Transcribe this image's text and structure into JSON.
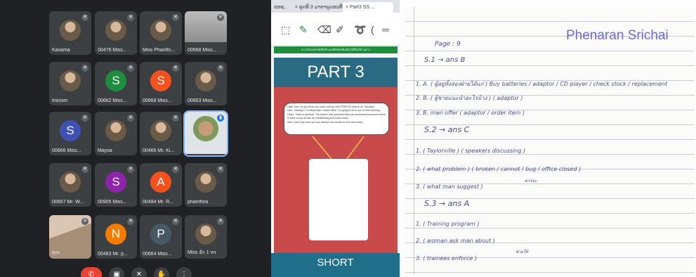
{
  "meeting": {
    "tiles": [
      {
        "name": "Kasama",
        "avatar": "photo",
        "color": "#607d8b",
        "active": false
      },
      {
        "name": "00476 Miss...",
        "avatar": "photo",
        "color": "#8d6e63",
        "active": false
      },
      {
        "name": "Miss Phanthi...",
        "avatar": "photo",
        "color": "#a1887f",
        "active": false
      },
      {
        "name": "00668 Miss...",
        "avatar": "wide",
        "color": "#9e9e9e",
        "active": false
      },
      {
        "name": "tnsnxm",
        "avatar": "photo",
        "color": "#4db6ac",
        "active": false
      },
      {
        "name": "00662 Miss...",
        "avatar": "S",
        "color": "#1e8e3e",
        "active": false
      },
      {
        "name": "00668 Miss...",
        "avatar": "S",
        "color": "#f4511e",
        "active": false
      },
      {
        "name": "00663 Miss...",
        "avatar": "photo",
        "color": "#8d6e63",
        "active": false
      },
      {
        "name": "00666 Miss...",
        "avatar": "S",
        "color": "#3f51b5",
        "active": false
      },
      {
        "name": "Maysa",
        "avatar": "photo",
        "color": "#795548",
        "active": false
      },
      {
        "name": "00466 Mr. Ki...",
        "avatar": "photo",
        "color": "#fbc02d",
        "active": false
      },
      {
        "name": "Warchuda",
        "avatar": "selfcam",
        "color": "#90a4ae",
        "active": true
      },
      {
        "name": "00667 Mr. W...",
        "avatar": "photo",
        "color": "#bcaaa4",
        "active": false
      },
      {
        "name": "00905 Miss...",
        "avatar": "S",
        "color": "#8e24aa",
        "active": false
      },
      {
        "name": "00494 Mr. R...",
        "avatar": "A",
        "color": "#f4511e",
        "active": false
      },
      {
        "name": "phanthira",
        "avatar": "photo",
        "color": "#9575cd",
        "active": false
      },
      {
        "name": "คุณ",
        "avatar": "selfie",
        "color": "#a58d76",
        "active": false
      },
      {
        "name": "00483 Mr. p...",
        "avatar": "N",
        "color": "#f57c00",
        "active": false
      },
      {
        "name": "00664 Miss...",
        "avatar": "P",
        "color": "#455a64",
        "active": false
      },
      {
        "name": "Miss อัก 1 หร",
        "avatar": "photo",
        "color": "#ffb74d",
        "active": false
      }
    ],
    "controls": [
      "end-call",
      "captions",
      "mic",
      "raise-hand",
      "more"
    ]
  },
  "browser": {
    "tabs": [
      "ຂອຊ..",
      "× ລຸດທີ 3 ມາຕາພູນອນທີ່ເອີ່ຍ",
      "× Part3 SS ..."
    ],
    "green_banner": "ดาวน์โหลดไฟล์เพื่อทำแบบฝึกหัดเพิ่มเติมได้ที่ลิงก์ด้านล่าง",
    "part_title": "PART 3",
    "bubble_lines": [
      "Hello Sam, do you think you could visit the MUTTERFOR branch on Tuesday?",
      "Sam: Tuesday? I'm afraid that I meant office. I'm going to be in out of town meeting.",
      "Helen: That's a problem. The branch has promised them we would send someone down",
      "to have a look at their air conditioning and power issue.",
      "Sam: Well, why don't you ask Harold? He should be free next week."
    ],
    "footer": "SHORT  CONVERSATIONS"
  },
  "notebook": {
    "owner": "Phenaran Srichai",
    "lines": [
      "Page : 9",
      "S.1  →  ans  B",
      "1. A.   ( ผู้อยู่ทั้งสองฝ่ายได้แก่ ) Buy batteries / adaptor / CD player / check stock / replacement",
      "2. B.   ( ผู้ชายแนะนำอะไรบ้าง ) ( adaptor )",
      "3. B.      man  offer    ( adaptor / order item )",
      "S.2  →  ans  C",
      "1.            ( Taylorville ) ( speakers discussing )",
      "2.            ( what problem )  ( broken / cannot / bug / office closed )",
      "3.            ( what  man  suggest )",
      "S.3  →  ans  A",
      "1.            ( Training  program )",
      "2.            ( woman  ask  man  about )",
      "3.            ( trainees  enforce )"
    ],
    "annotations": [
      "ควรจะ",
      "ช่วยให้"
    ]
  }
}
